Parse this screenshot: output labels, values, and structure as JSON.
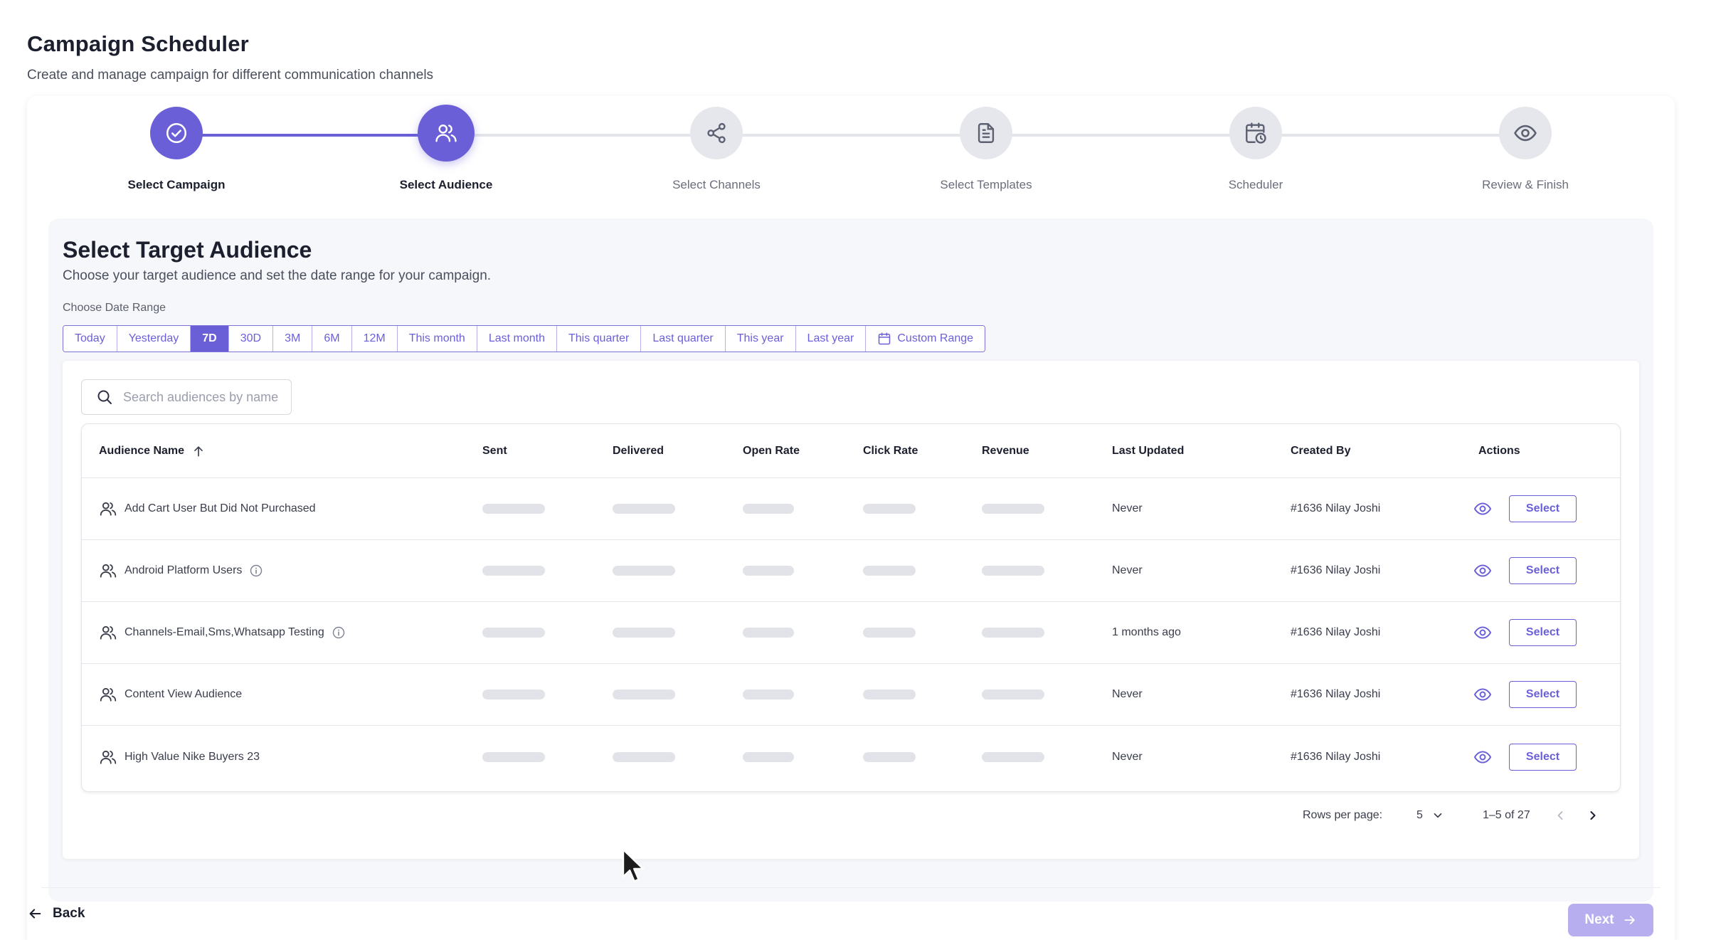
{
  "header": {
    "title": "Campaign Scheduler",
    "subtitle": "Create and manage campaign for different communication channels"
  },
  "stepper": {
    "steps": [
      {
        "label": "Select Campaign",
        "state": "completed",
        "icon": "check-circle-icon"
      },
      {
        "label": "Select Audience",
        "state": "current",
        "icon": "users-icon"
      },
      {
        "label": "Select Channels",
        "state": "pending",
        "icon": "share-icon"
      },
      {
        "label": "Select Templates",
        "state": "pending",
        "icon": "file-text-icon"
      },
      {
        "label": "Scheduler",
        "state": "pending",
        "icon": "calendar-clock-icon"
      },
      {
        "label": "Review & Finish",
        "state": "pending",
        "icon": "eye-icon"
      }
    ]
  },
  "audience": {
    "title": "Select Target Audience",
    "subtitle": "Choose your target audience and set the date range for your campaign.",
    "date_range_label": "Choose Date Range",
    "ranges": [
      "Today",
      "Yesterday",
      "7D",
      "30D",
      "3M",
      "6M",
      "12M",
      "This month",
      "Last month",
      "This quarter",
      "Last quarter",
      "This year",
      "Last year",
      "Custom Range"
    ],
    "selected_range": "7D",
    "search_placeholder": "Search audiences by name",
    "search_value": ""
  },
  "table": {
    "columns": [
      "Audience Name",
      "Sent",
      "Delivered",
      "Open Rate",
      "Click Rate",
      "Revenue",
      "Last Updated",
      "Created By",
      "Actions"
    ],
    "sort": {
      "column": "Audience Name",
      "direction": "ascending"
    },
    "rows": [
      {
        "name": "Add Cart User But Did Not Purchased",
        "info": false,
        "last_updated": "Never",
        "created_by": "#1636 Nilay Joshi",
        "action": "Select"
      },
      {
        "name": "Android Platform Users",
        "info": true,
        "last_updated": "Never",
        "created_by": "#1636 Nilay Joshi",
        "action": "Select"
      },
      {
        "name": "Channels-Email,Sms,Whatsapp Testing",
        "info": true,
        "last_updated": "1 months ago",
        "created_by": "#1636 Nilay Joshi",
        "action": "Select"
      },
      {
        "name": "Content View Audience",
        "info": false,
        "last_updated": "Never",
        "created_by": "#1636 Nilay Joshi",
        "action": "Select"
      },
      {
        "name": "High Value Nike Buyers 23",
        "info": false,
        "last_updated": "Never",
        "created_by": "#1636 Nilay Joshi",
        "action": "Select"
      }
    ]
  },
  "pagination": {
    "rows_per_page_label": "Rows per page:",
    "rows_per_page": "5",
    "range_text": "1–5 of 27"
  },
  "footer": {
    "back_label": "Back",
    "next_label": "Next"
  },
  "colors": {
    "accent": "#6b5fd8",
    "accent_disabled": "#b6aeee",
    "skeleton": "#e2e3e8"
  }
}
